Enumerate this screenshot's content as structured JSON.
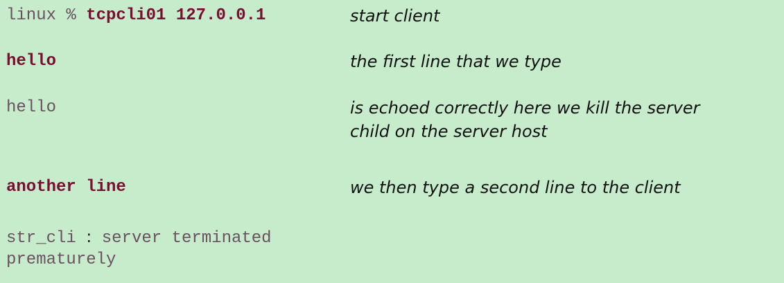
{
  "rows": [
    {
      "prompt": "linux % ",
      "command": "tcpcli01 127.0.0.1",
      "note": "start client"
    },
    {
      "command": "hello",
      "note": "the first line that we type"
    },
    {
      "output": "hello",
      "note_line1": "is echoed correctly here we kill the server",
      "note_line2": "child on the server host"
    },
    {
      "command": "another line",
      "note": "we then type a second line to the client"
    },
    {
      "output_prefix": "str_cli",
      "separator": ":",
      "output_line1_rest": "server terminated",
      "output_line2": "prematurely"
    }
  ]
}
